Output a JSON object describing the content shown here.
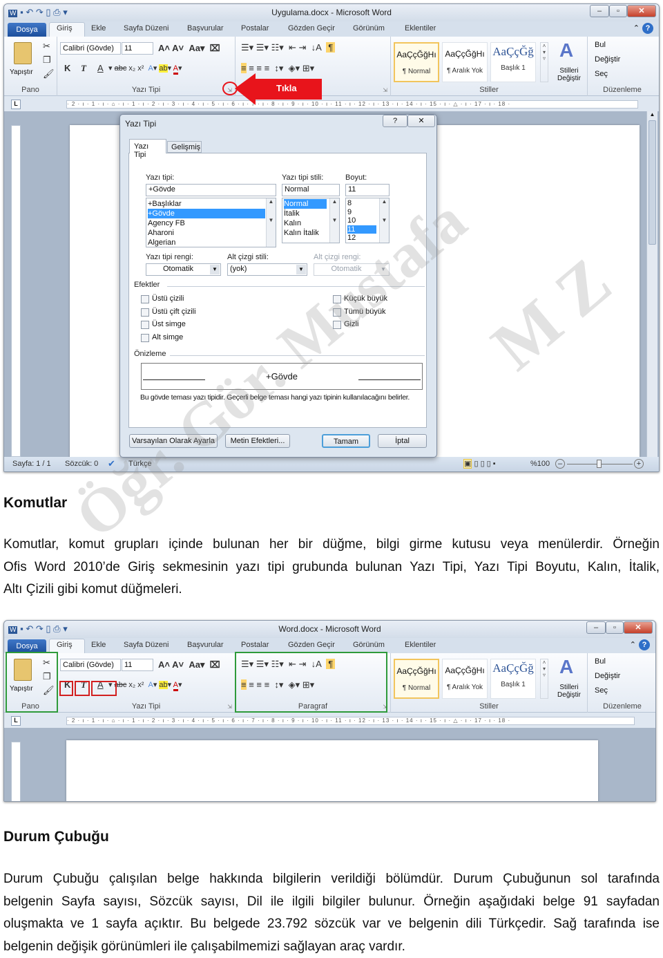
{
  "window1": {
    "title": "Uygulama.docx - Microsoft Word",
    "status": {
      "page": "Sayfa: 1 / 1",
      "words": "Sözcük: 0",
      "language": "Türkçe",
      "zoom": "%100"
    }
  },
  "window2": {
    "title": "Word.docx - Microsoft Word"
  },
  "ribbon": {
    "file_tab": "Dosya",
    "tabs": [
      "Giriş",
      "Ekle",
      "Sayfa Düzeni",
      "Başvurular",
      "Postalar",
      "Gözden Geçir",
      "Görünüm",
      "Eklentiler"
    ],
    "paste": "Yapıştır",
    "font_name": "Calibri (Gövde)",
    "font_size": "11",
    "bold": "K",
    "italic": "T",
    "underline": "A",
    "groups": {
      "clipboard": "Pano",
      "font": "Yazı Tipi",
      "paragraph": "Paragraf",
      "styles": "Stiller",
      "editing": "Düzenleme"
    },
    "styles": [
      {
        "sample": "AaÇçĞğHı",
        "name": "¶ Normal"
      },
      {
        "sample": "AaÇçĞğHı",
        "name": "¶ Aralık Yok"
      },
      {
        "sample": "AaÇçĞğ",
        "name": "Başlık 1"
      }
    ],
    "change_styles": "Stilleri Değiştir",
    "find": "Bul",
    "replace": "Değiştir",
    "select": "Seç",
    "ruler": "· 2 · ı · 1 · ı · ⌂ · ı · 1 · ı · 2 · ı · 3 · ı · 4 · ı · 5 · ı · 6 · ı · 7 · ı · 8 · ı · 9 · ı · 10 · ı · 11 · ı · 12 · ı · 13 · ı · 14 · ı · 15 · ı · △ · ı · 17 · ı · 18 ·"
  },
  "callout": {
    "text": "Tıkla",
    "color": "#e8141b"
  },
  "dialog": {
    "title": "Yazı Tipi",
    "tabs": [
      "Yazı Tipi",
      "Gelişmiş"
    ],
    "font_label": "Yazı tipi:",
    "font_value": "+Gövde",
    "font_list": [
      "+Başlıklar",
      "+Gövde",
      "Agency FB",
      "Aharoni",
      "Algerian"
    ],
    "style_label": "Yazı tipi stili:",
    "style_value": "Normal",
    "style_list": [
      "Normal",
      "İtalik",
      "Kalın",
      "Kalın İtalik"
    ],
    "size_label": "Boyut:",
    "size_value": "11",
    "size_list": [
      "8",
      "9",
      "10",
      "11",
      "12"
    ],
    "color_label": "Yazı tipi rengi:",
    "color_value": "Otomatik",
    "underline_label": "Alt çizgi stili:",
    "underline_value": "(yok)",
    "underline_color_label": "Alt çizgi rengi:",
    "underline_color_value": "Otomatik",
    "effects_label": "Efektler",
    "effects_left": [
      "Üstü çizili",
      "Üstü çift çizili",
      "Üst simge",
      "Alt simge"
    ],
    "effects_right": [
      "Küçük büyük",
      "Tümü büyük",
      "Gizli"
    ],
    "preview_label": "Önizleme",
    "preview_text": "+Gövde",
    "description": "Bu gövde teması yazı tipidir. Geçerli belge teması hangi yazı tipinin kullanılacağını belirler.",
    "buttons": {
      "default": "Varsayılan Olarak Ayarla",
      "text_effects": "Metin Efektleri...",
      "ok": "Tamam",
      "cancel": "İptal"
    }
  },
  "section1": {
    "heading": "Komutlar",
    "lines": [
      "Komutlar, komut grupları içinde bulunan her bir düğme, bilgi girme kutusu veya menülerdir. Örneğin",
      "Ofis Word 2010’de Giriş sekmesinin yazı tipi grubunda bulunan Yazı Tipi, Yazı Tipi Boyutu, Kalın, İtalik,",
      "Altı Çizili gibi komut düğmeleri."
    ]
  },
  "section2": {
    "heading": "Durum Çubuğu",
    "lines": [
      "Durum Çubuğu çalışılan belge hakkında bilgilerin verildiği bölümdür. Durum Çubuğunun sol tarafında",
      "belgenin Sayfa sayısı, Sözcük sayısı, Dil ile ilgili bilgiler bulunur. Örneğin aşağıdaki belge 91 sayfadan",
      "oluşmakta ve 1 sayfa açıktır. Bu belgede 23.792 sözcük var ve belgenin dili Türkçedir. Sağ tarafında ise",
      "belgenin değişik görünümleri ile çalışabilmemizi sağlayan araç vardır."
    ]
  },
  "watermark": {
    "line1": "Öğr. Gör. Mustafa",
    "line2": "M Z"
  },
  "highlight_colors": {
    "group_box": "#2e9a3a",
    "command_box": "#d21f1f"
  }
}
